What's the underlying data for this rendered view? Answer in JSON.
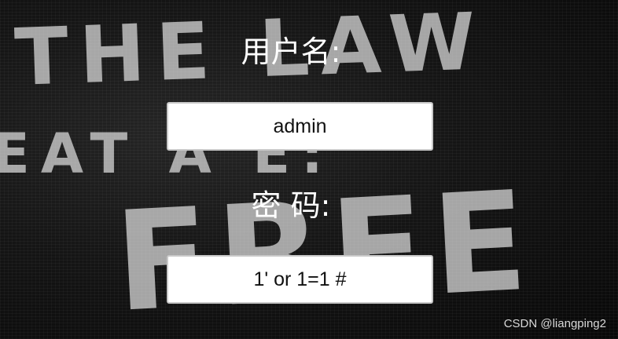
{
  "form": {
    "username_label": "用户名:",
    "username_value": "admin",
    "password_label": "密 码:",
    "password_value": "1' or 1=1 #"
  },
  "background": {
    "line1": "THE LAW",
    "line2": "EAT A   E:",
    "line3": "FREE"
  },
  "watermark": "CSDN @liangping2",
  "colors": {
    "label": "#ffffff",
    "input_bg": "#ffffff",
    "input_text": "#111111",
    "background": "#0d0d0d"
  }
}
